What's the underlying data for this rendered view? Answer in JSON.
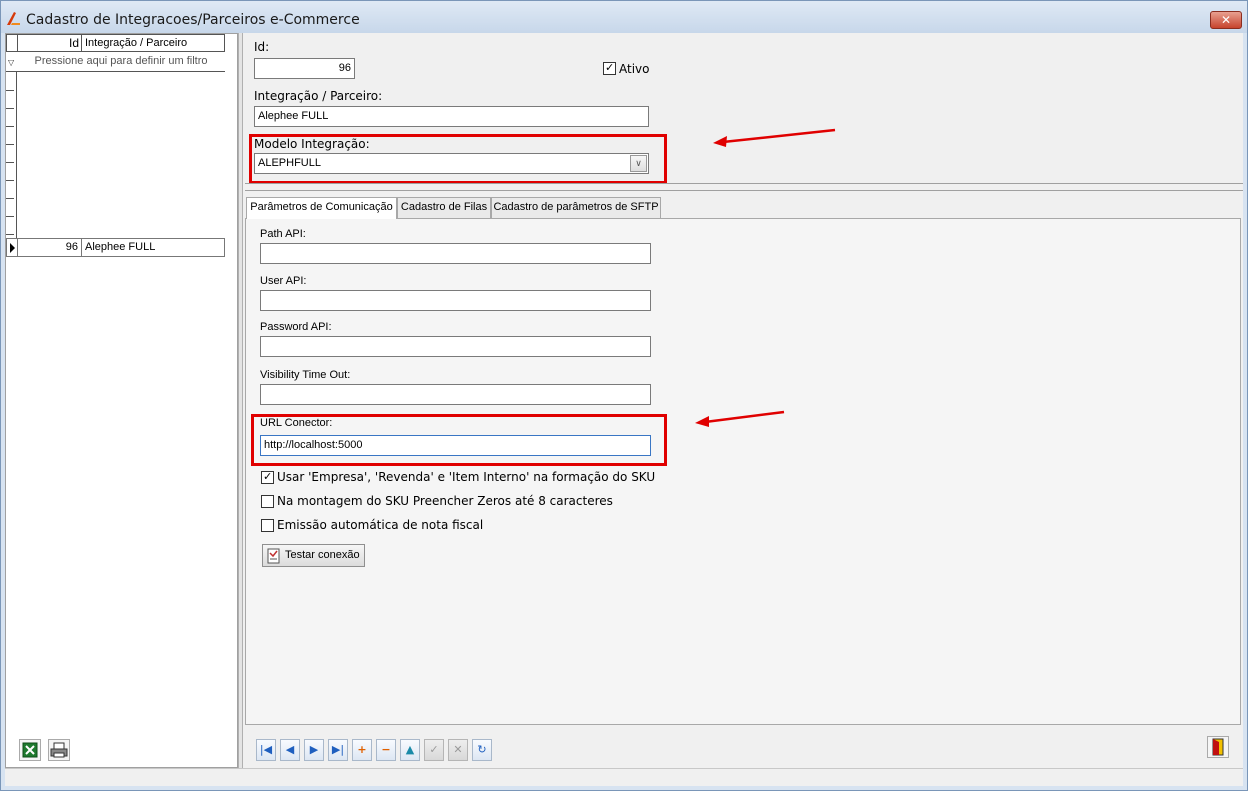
{
  "window": {
    "title": "Cadastro de Integracoes/Parceiros e-Commerce",
    "close_label": "✕"
  },
  "grid": {
    "col_id": "Id",
    "col_name": "Integração / Parceiro",
    "filter_hint": "Pressione aqui para definir um filtro",
    "rows": [
      {
        "id": "96",
        "name": "Alephee FULL"
      }
    ]
  },
  "form": {
    "id_label": "Id:",
    "id_value": "96",
    "ativo_label": "Ativo",
    "ativo_checked": true,
    "partner_label": "Integração / Parceiro:",
    "partner_value": "Alephee FULL",
    "model_label": "Modelo Integração:",
    "model_value": "ALEPHFULL"
  },
  "tabs": [
    {
      "label": "Parâmetros de Comunicação",
      "active": true
    },
    {
      "label": "Cadastro de Filas",
      "active": false
    },
    {
      "label": "Cadastro de parâmetros de SFTP",
      "active": false
    }
  ],
  "comm": {
    "path_label": "Path API:",
    "path_value": "",
    "user_label": "User API:",
    "user_value": "",
    "password_label": "Password API:",
    "password_value": "",
    "visibility_label": "Visibility Time Out:",
    "visibility_value": "",
    "url_label": "URL Conector:",
    "url_value": "http://localhost:5000"
  },
  "options": [
    {
      "label": "Usar 'Empresa', 'Revenda' e 'Item Interno' na formação do SKU",
      "checked": true
    },
    {
      "label": "Na montagem do SKU Preencher Zeros até 8 caracteres",
      "checked": false
    },
    {
      "label": "Emissão automática de nota fiscal",
      "checked": false
    }
  ],
  "test_button": "Testar conexão",
  "colors": {
    "highlight": "#e00000",
    "nav_arrow": "#1f5fbf",
    "nav_plus": "#e06000"
  },
  "icons": {
    "first": "first-record-icon",
    "prev": "previous-record-icon",
    "next": "next-record-icon",
    "last": "last-record-icon",
    "insert": "insert-icon",
    "delete": "delete-icon",
    "edit": "edit-icon",
    "post": "post-icon",
    "cancel": "cancel-icon",
    "refresh": "refresh-icon",
    "excel": "excel-export-icon",
    "print": "print-icon",
    "exit": "exit-door-icon"
  }
}
